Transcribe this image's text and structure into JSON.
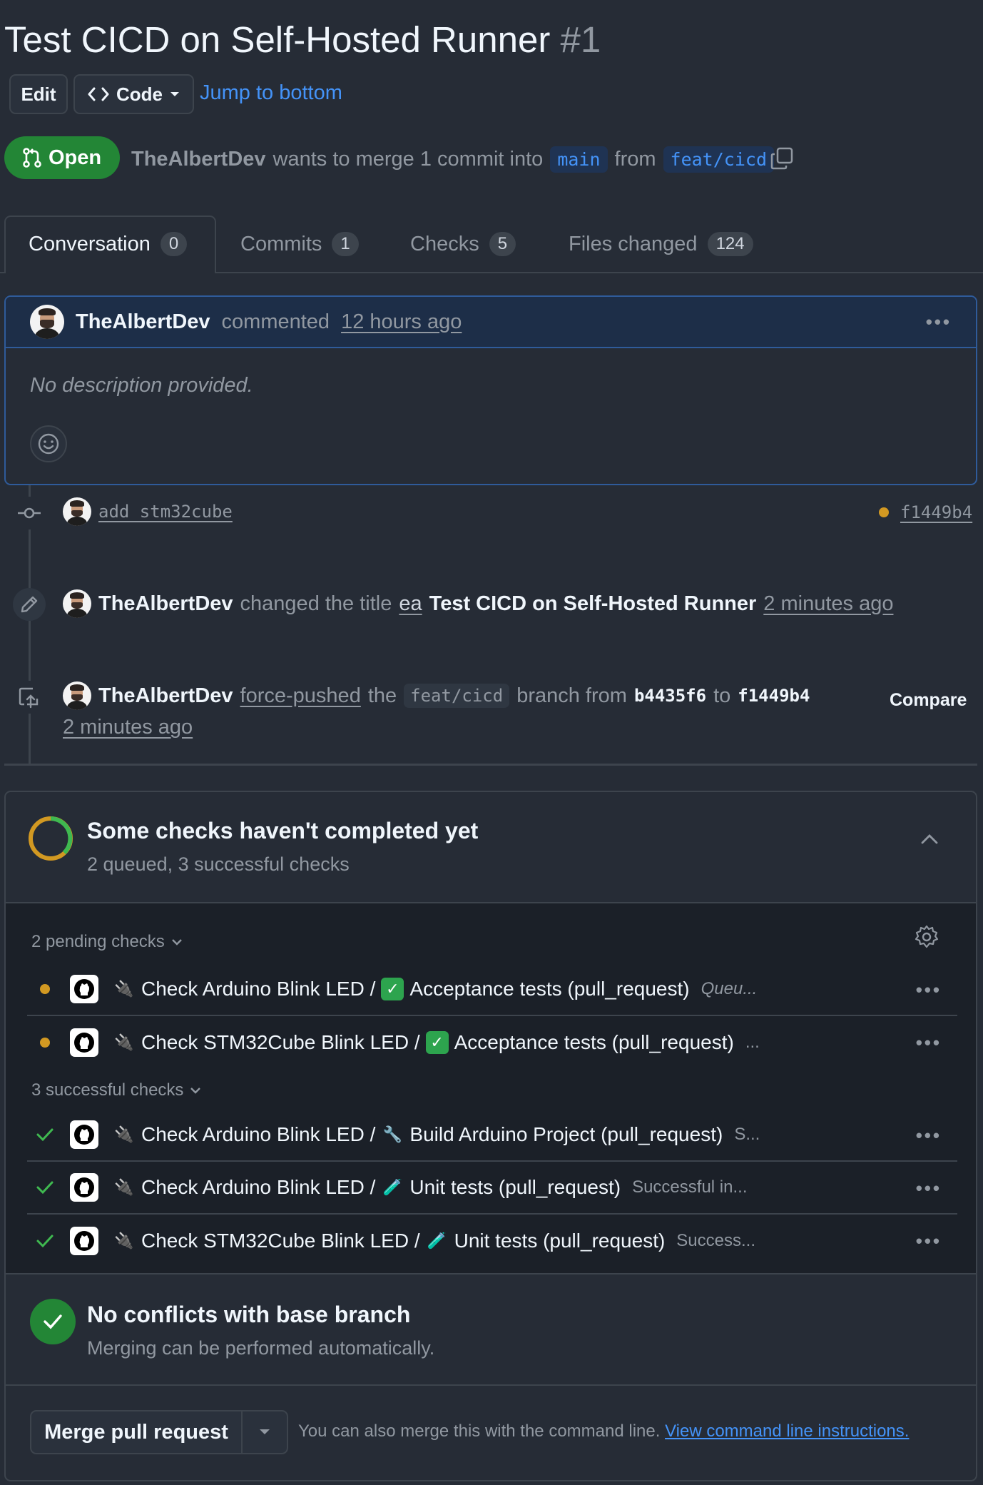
{
  "pr": {
    "title": "Test CICD on Self-Hosted Runner",
    "number": "#1",
    "edit_label": "Edit",
    "code_label": "Code",
    "jump_label": "Jump to bottom",
    "state": "Open",
    "author": "TheAlbertDev",
    "merge_text": "wants to merge 1 commit into",
    "base_branch": "main",
    "from_text": "from",
    "head_branch": "feat/cicd"
  },
  "tabs": [
    {
      "label": "Conversation",
      "count": "0"
    },
    {
      "label": "Commits",
      "count": "1"
    },
    {
      "label": "Checks",
      "count": "5"
    },
    {
      "label": "Files changed",
      "count": "124"
    }
  ],
  "comment": {
    "author": "TheAlbertDev",
    "action": "commented",
    "time": "12 hours ago",
    "body": "No description provided."
  },
  "timeline": {
    "commit": {
      "message": "add stm32cube",
      "sha": "f1449b4",
      "status_color": "#d29922"
    },
    "rename": {
      "author": "TheAlbertDev",
      "text": "changed the title",
      "old_title": "ea",
      "new_title": "Test CICD on Self-Hosted Runner",
      "time": "2 minutes ago"
    },
    "push": {
      "author": "TheAlbertDev",
      "action": "force-pushed",
      "the": "the",
      "branch": "feat/cicd",
      "branch_from": "branch from",
      "from_sha": "b4435f6",
      "to": "to",
      "to_sha": "f1449b4",
      "time": "2 minutes ago",
      "compare_label": "Compare"
    }
  },
  "merge_box": {
    "checks_title": "Some checks haven't completed yet",
    "checks_sub": "2 queued, 3 successful checks",
    "pending_label": "2 pending checks",
    "success_label": "3 successful checks",
    "checks": [
      {
        "status": "pending",
        "workflow": "Check Arduino Blink LED /",
        "emoji": "✓",
        "emoji_kind": "green-check",
        "job": "Acceptance tests (pull_request)",
        "desc": "Queu..."
      },
      {
        "status": "pending",
        "workflow": "Check STM32Cube Blink LED /",
        "emoji": "✓",
        "emoji_kind": "green-check",
        "job": "Acceptance tests (pull_request)",
        "desc": "..."
      },
      {
        "status": "success",
        "workflow": "Check Arduino Blink LED /",
        "emoji": "🔧",
        "emoji_kind": "wrench",
        "job": "Build Arduino Project (pull_request)",
        "desc": "S..."
      },
      {
        "status": "success",
        "workflow": "Check Arduino Blink LED /",
        "emoji": "🧪",
        "emoji_kind": "test-tube",
        "job": "Unit tests (pull_request)",
        "desc": "Successful in..."
      },
      {
        "status": "success",
        "workflow": "Check STM32Cube Blink LED /",
        "emoji": "🧪",
        "emoji_kind": "test-tube",
        "job": "Unit tests (pull_request)",
        "desc": "Success..."
      }
    ],
    "conflict_title": "No conflicts with base branch",
    "conflict_sub": "Merging can be performed automatically.",
    "merge_label": "Merge pull request",
    "merge_hint": "You can also merge this with the command line.",
    "merge_link": "View command line instructions."
  },
  "colors": {
    "background": "#262c36",
    "accent": "#4493f8",
    "open_green": "#238636",
    "pending": "#d29922",
    "success": "#3fb950"
  }
}
